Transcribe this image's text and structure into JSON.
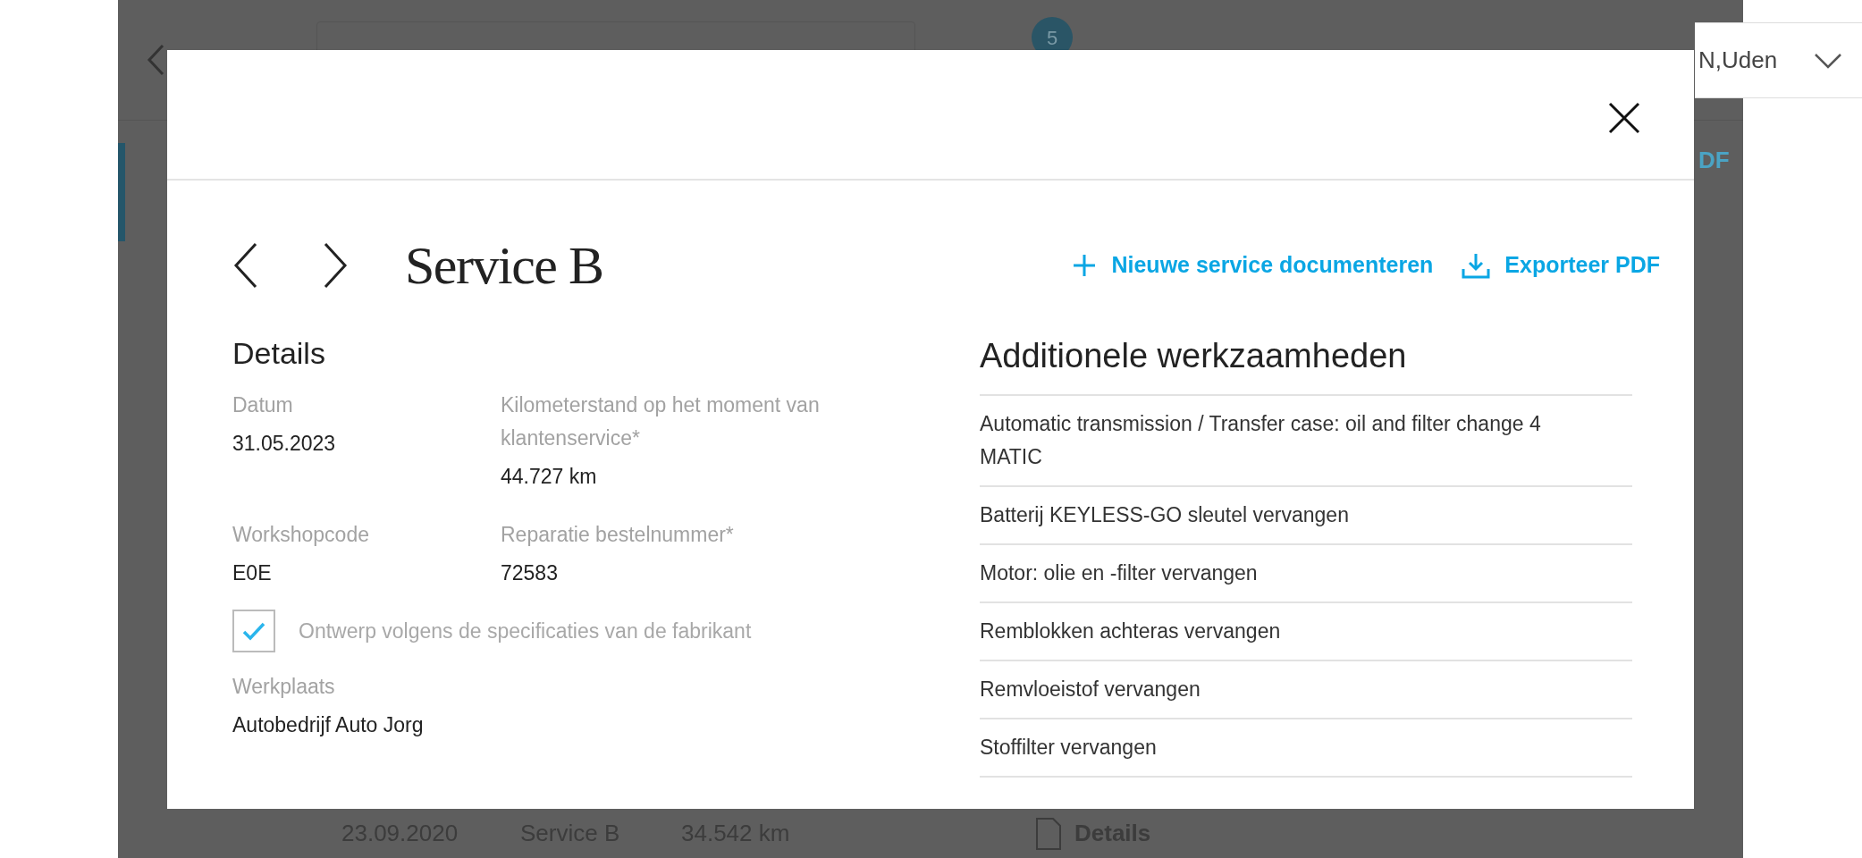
{
  "background": {
    "badge": "5",
    "location": "N,Uden",
    "export_link": "DF",
    "row": {
      "date": "23.09.2020",
      "service": "Service B",
      "mileage": "34.542 km",
      "details": "Details"
    }
  },
  "modal": {
    "title": "Service B",
    "actions": [
      {
        "kind": "add",
        "label": "Nieuwe service documenteren"
      },
      {
        "kind": "export",
        "label": "Exporteer PDF"
      }
    ],
    "details": {
      "heading": "Details",
      "fields": [
        {
          "label": "Datum",
          "value": "31.05.2023"
        },
        {
          "label": "Kilometerstand op het moment van klantenservice*",
          "value": "44.727 km"
        },
        {
          "label": "Workshopcode",
          "value": "E0E"
        },
        {
          "label": "Reparatie bestelnummer*",
          "value": "72583"
        }
      ],
      "checkbox": {
        "label": "Ontwerp volgens de specificaties van de fabrikant",
        "checked": true
      },
      "workplace": {
        "label": "Werkplaats",
        "value": "Autobedrijf Auto Jorg"
      }
    },
    "additional": {
      "heading": "Additionele werkzaamheden",
      "items": [
        "Automatic transmission / Transfer case: oil and filter change 4 MATIC",
        "Batterij KEYLESS-GO sleutel vervangen",
        "Motor: olie en -filter vervangen",
        "Remblokken achteras vervangen",
        "Remvloeistof vervangen",
        "Stoffilter vervangen"
      ]
    }
  }
}
